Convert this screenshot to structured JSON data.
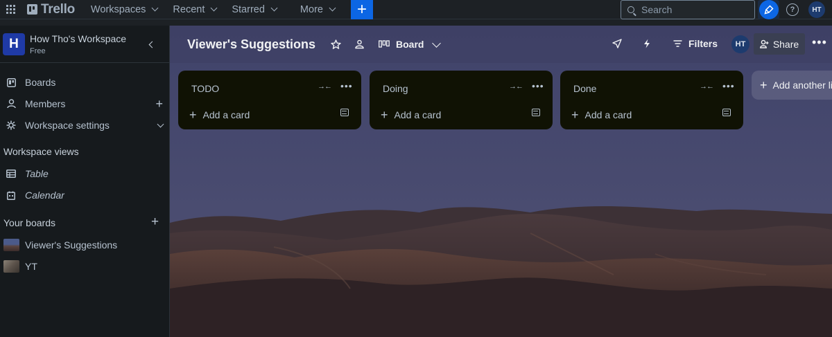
{
  "topnav": {
    "logo_text": "Trello",
    "menu": [
      {
        "label": "Workspaces"
      },
      {
        "label": "Recent"
      },
      {
        "label": "Starred"
      },
      {
        "label": "More"
      }
    ],
    "create_label": "+",
    "search_placeholder": "Search",
    "help_label": "?",
    "avatar_initials": "HT"
  },
  "sidebar": {
    "workspace": {
      "logo_letter": "H",
      "name": "How Tho's Workspace",
      "plan": "Free"
    },
    "items": [
      {
        "label": "Boards",
        "icon": "board-icon"
      },
      {
        "label": "Members",
        "icon": "member-icon",
        "action": "+"
      },
      {
        "label": "Workspace settings",
        "icon": "gear-icon"
      }
    ],
    "views_heading": "Workspace views",
    "views": [
      {
        "label": "Table",
        "icon": "table-icon"
      },
      {
        "label": "Calendar",
        "icon": "calendar-icon"
      }
    ],
    "boards_heading": "Your boards",
    "boards_add": "+",
    "boards": [
      {
        "label": "Viewer's Suggestions",
        "thumb_color": "#4b5a8a"
      },
      {
        "label": "YT",
        "thumb_color": "#6b6257"
      }
    ]
  },
  "board": {
    "title": "Viewer's Suggestions",
    "view_label": "Board",
    "filters_label": "Filters",
    "avatar_initials": "HT",
    "share_label": "Share",
    "lists": [
      {
        "title": "TODO",
        "add_card": "Add a card"
      },
      {
        "title": "Doing",
        "add_card": "Add a card"
      },
      {
        "title": "Done",
        "add_card": "Add a card"
      }
    ],
    "add_list_label": "Add another list"
  },
  "colors": {
    "nav_bg": "#1d2125",
    "sidebar_bg": "#161a1d",
    "list_bg": "#101204",
    "accent": "#0c66e4",
    "board_bg": "#474a6e"
  }
}
